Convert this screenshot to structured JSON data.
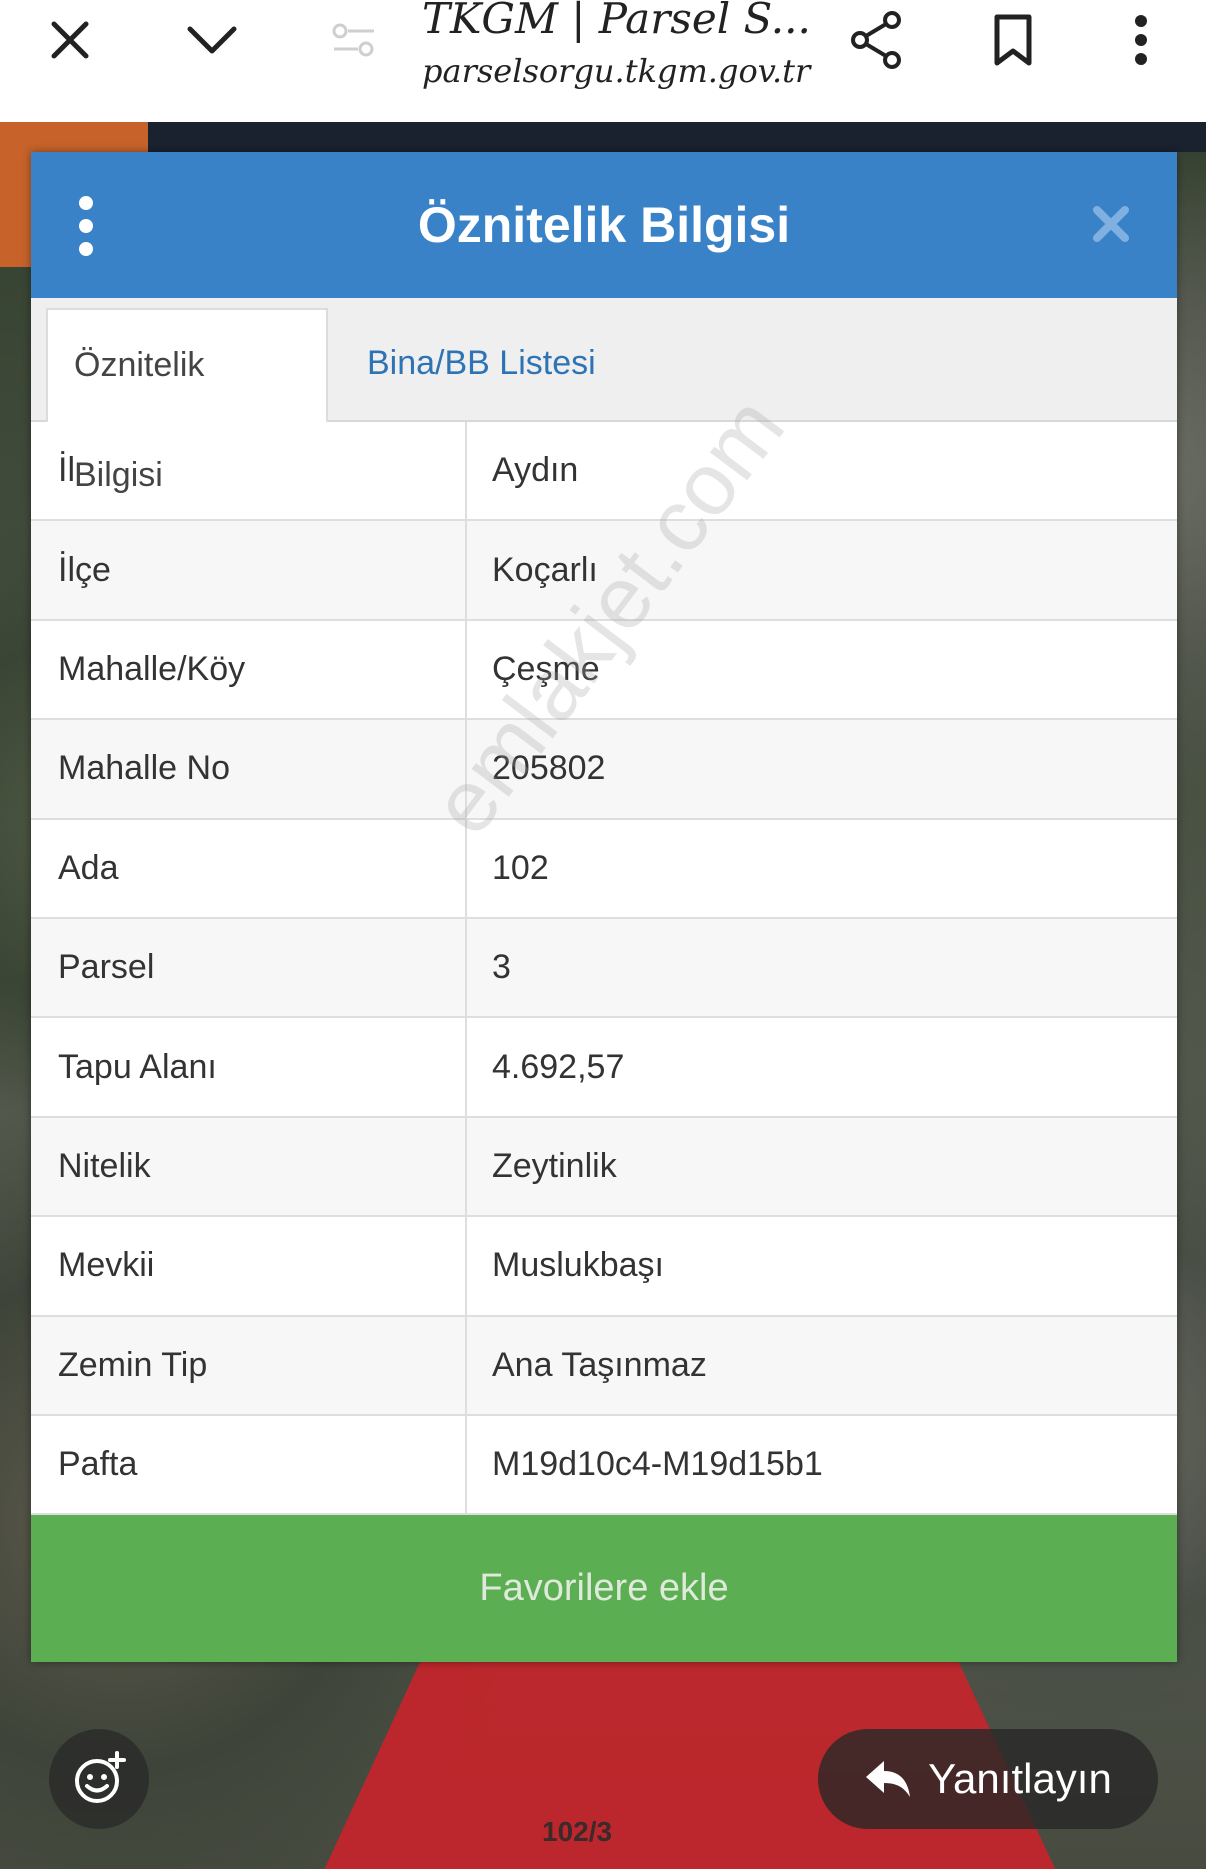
{
  "browser": {
    "title": "TKGM | Parsel S...",
    "url": "parselsorgu.tkgm.gov.tr",
    "icons": [
      "close-icon",
      "chevron-down-icon",
      "tune-icon",
      "share-icon",
      "bookmark-icon",
      "more-vert-icon"
    ]
  },
  "dialog": {
    "title": "Öznitelik Bilgisi",
    "tabs": [
      {
        "label": "Öznitelik Bilgisi",
        "active": true
      },
      {
        "label": "Bina/BB Listesi",
        "active": false
      }
    ],
    "rows": [
      {
        "label": "İl",
        "value": "Aydın"
      },
      {
        "label": "İlçe",
        "value": "Koçarlı"
      },
      {
        "label": "Mahalle/Köy",
        "value": "Çeşme"
      },
      {
        "label": "Mahalle No",
        "value": "205802"
      },
      {
        "label": "Ada",
        "value": "102"
      },
      {
        "label": "Parsel",
        "value": "3"
      },
      {
        "label": "Tapu Alanı",
        "value": "4.692,57"
      },
      {
        "label": "Nitelik",
        "value": "Zeytinlik"
      },
      {
        "label": "Mevkii",
        "value": "Muslukbaşı"
      },
      {
        "label": "Zemin Tip",
        "value": "Ana Taşınmaz"
      },
      {
        "label": "Pafta",
        "value": "M19d10c4-M19d15b1"
      }
    ],
    "favorite_label": "Favorilere ekle",
    "watermark": "emlakjet.com"
  },
  "overlay": {
    "reply_label": "Yanıtlayın",
    "map_label": "102/3"
  },
  "colors": {
    "header_blue": "#3a82c8",
    "button_green": "#5cae53",
    "tab_link_blue": "#2e74b5",
    "parcel_red": "#c8232a"
  }
}
